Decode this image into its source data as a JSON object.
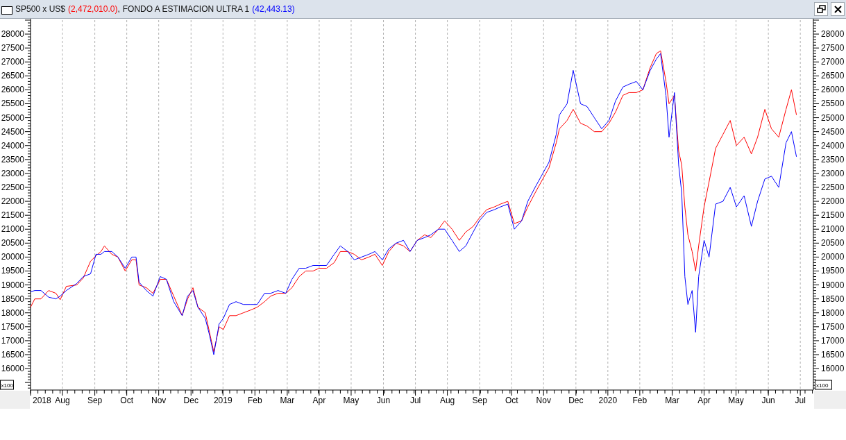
{
  "window": {
    "readings": [
      "(2,472,010.0)",
      "(42,443.13)"
    ],
    "separator": ","
  },
  "chart": {
    "y_multiplier_left": "x100",
    "y_multiplier_right": "x100",
    "left_axis_labels": [
      "28000",
      "27500",
      "27000",
      "26500",
      "26000",
      "25500",
      "25000",
      "24500",
      "24000",
      "23500",
      "23000",
      "22500",
      "22000",
      "21500",
      "21000",
      "20500",
      "20000",
      "19500",
      "19000",
      "18500",
      "18000",
      "17500",
      "17000",
      "16500",
      "16000"
    ],
    "right_axis_labels": [
      "28000",
      "27500",
      "27000",
      "26500",
      "26000",
      "25500",
      "25000",
      "24500",
      "24000",
      "23500",
      "23000",
      "22500",
      "22000",
      "21500",
      "21000",
      "20500",
      "20000",
      "19500",
      "19000",
      "18500",
      "18000",
      "17500",
      "17000",
      "16500",
      "16000"
    ],
    "chart_data": {
      "type": "line",
      "x": [
        2018.5,
        2018.511,
        2018.527,
        2018.547,
        2018.566,
        2018.577,
        2018.593,
        2018.62,
        2018.637,
        2018.656,
        2018.67,
        2018.683,
        2018.692,
        2018.711,
        2018.727,
        2018.746,
        2018.763,
        2018.774,
        2018.782,
        2018.801,
        2018.818,
        2018.837,
        2018.853,
        2018.872,
        2018.894,
        2018.908,
        2018.922,
        2018.935,
        2018.954,
        2018.965,
        2018.976,
        2018.99,
        2019.001,
        2019.017,
        2019.034,
        2019.053,
        2019.072,
        2019.089,
        2019.108,
        2019.124,
        2019.143,
        2019.163,
        2019.179,
        2019.198,
        2019.215,
        2019.234,
        2019.25,
        2019.269,
        2019.289,
        2019.305,
        2019.324,
        2019.341,
        2019.36,
        2019.379,
        2019.395,
        2019.414,
        2019.431,
        2019.45,
        2019.469,
        2019.486,
        2019.505,
        2019.524,
        2019.54,
        2019.56,
        2019.576,
        2019.595,
        2019.614,
        2019.631,
        2019.65,
        2019.666,
        2019.685,
        2019.705,
        2019.721,
        2019.74,
        2019.757,
        2019.776,
        2019.792,
        2019.811,
        2019.831,
        2019.847,
        2019.866,
        2019.874,
        2019.894,
        2019.91,
        2019.929,
        2019.946,
        2019.965,
        2019.984,
        2020.003,
        2020.02,
        2020.039,
        2020.055,
        2020.074,
        2020.091,
        2020.11,
        2020.126,
        2020.137,
        2020.151,
        2020.159,
        2020.173,
        2020.184,
        2020.192,
        2020.2,
        2020.208,
        2020.219,
        2020.228,
        2020.236,
        2020.25,
        2020.263,
        2020.28,
        2020.299,
        2020.318,
        2020.334,
        2020.354,
        2020.373,
        2020.389,
        2020.408,
        2020.425,
        2020.444,
        2020.463,
        2020.477,
        2020.49
      ],
      "series": [
        {
          "name": "SP500 x US$",
          "color": "#ff0000",
          "values": [
            18200,
            18500,
            18500,
            18800,
            18700,
            18470,
            18950,
            19000,
            19250,
            19850,
            20050,
            20200,
            20400,
            20100,
            20000,
            19500,
            19900,
            19900,
            19000,
            18900,
            18700,
            19200,
            19200,
            18600,
            17900,
            18500,
            18900,
            18200,
            18000,
            17300,
            16600,
            17500,
            17400,
            17900,
            17900,
            18000,
            18100,
            18200,
            18400,
            18600,
            18700,
            18700,
            18900,
            19300,
            19500,
            19500,
            19600,
            19600,
            19800,
            20200,
            20200,
            20100,
            19900,
            20000,
            20100,
            19700,
            20200,
            20500,
            20400,
            20200,
            20600,
            20800,
            20700,
            21000,
            21300,
            21000,
            20600,
            20900,
            21100,
            21400,
            21700,
            21800,
            21900,
            22000,
            21200,
            21300,
            21800,
            22300,
            22800,
            23200,
            24100,
            24600,
            24900,
            25300,
            24800,
            24700,
            24500,
            24500,
            24800,
            25200,
            25800,
            25900,
            25900,
            26000,
            26800,
            27300,
            27400,
            26300,
            25500,
            25800,
            23800,
            23300,
            21800,
            20800,
            20200,
            19500,
            20400,
            21800,
            22700,
            23900,
            24400,
            24900,
            24000,
            24300,
            23700,
            24300,
            25300,
            24600,
            24300,
            25300,
            26000,
            25100
          ]
        },
        {
          "name": "FONDO A ESTIMACION  ULTRA 1",
          "color": "#0000ff",
          "values": [
            18750,
            18800,
            18800,
            18560,
            18500,
            18600,
            18800,
            19050,
            19300,
            19400,
            20100,
            20100,
            20200,
            20200,
            20000,
            19600,
            20000,
            20000,
            19100,
            18800,
            18600,
            19300,
            19200,
            18400,
            17900,
            18600,
            18800,
            18200,
            17800,
            17200,
            16500,
            17600,
            17800,
            18300,
            18400,
            18300,
            18300,
            18300,
            18700,
            18700,
            18800,
            18700,
            19200,
            19600,
            19600,
            19700,
            19700,
            19700,
            20100,
            20400,
            20200,
            19900,
            20000,
            20100,
            20200,
            19900,
            20300,
            20500,
            20600,
            20200,
            20600,
            20700,
            20800,
            21000,
            21000,
            20600,
            20200,
            20400,
            20900,
            21300,
            21600,
            21700,
            21800,
            21900,
            21000,
            21300,
            22000,
            22500,
            23000,
            23400,
            24400,
            25100,
            25500,
            26700,
            25500,
            25400,
            25000,
            24600,
            24900,
            25600,
            26100,
            26200,
            26300,
            26000,
            26700,
            27100,
            27300,
            25800,
            24300,
            25900,
            23300,
            22300,
            19300,
            18300,
            18800,
            17300,
            19300,
            20600,
            20000,
            21900,
            22000,
            22500,
            21800,
            22200,
            21100,
            22000,
            22800,
            22900,
            22500,
            24100,
            24500,
            23600
          ]
        }
      ],
      "xlim": [
        2018.5,
        2020.534
      ],
      "ylim": [
        15230,
        28500
      ],
      "grid": true,
      "xticks": [
        {
          "value": 2018.5,
          "label": "2018"
        },
        {
          "value": 2018.583,
          "label": "Aug"
        },
        {
          "value": 2018.667,
          "label": "Sep"
        },
        {
          "value": 2018.75,
          "label": "Oct"
        },
        {
          "value": 2018.833,
          "label": "Nov"
        },
        {
          "value": 2018.917,
          "label": "Dec"
        },
        {
          "value": 2019,
          "label": "2019"
        },
        {
          "value": 2019.083,
          "label": "Feb"
        },
        {
          "value": 2019.167,
          "label": "Mar"
        },
        {
          "value": 2019.25,
          "label": "Apr"
        },
        {
          "value": 2019.333,
          "label": "May"
        },
        {
          "value": 2019.417,
          "label": "Jun"
        },
        {
          "value": 2019.5,
          "label": "Jul"
        },
        {
          "value": 2019.583,
          "label": "Aug"
        },
        {
          "value": 2019.667,
          "label": "Sep"
        },
        {
          "value": 2019.75,
          "label": "Oct"
        },
        {
          "value": 2019.833,
          "label": "Nov"
        },
        {
          "value": 2019.917,
          "label": "Dec"
        },
        {
          "value": 2020,
          "label": "2020"
        },
        {
          "value": 2020.083,
          "label": "Feb"
        },
        {
          "value": 2020.167,
          "label": "Mar"
        },
        {
          "value": 2020.25,
          "label": "Apr"
        },
        {
          "value": 2020.333,
          "label": "May"
        },
        {
          "value": 2020.417,
          "label": "Jun"
        },
        {
          "value": 2020.5,
          "label": "Jul"
        }
      ],
      "yticks": [
        16000,
        16500,
        17000,
        17500,
        18000,
        18500,
        19000,
        19500,
        20000,
        20500,
        21000,
        21500,
        22000,
        22500,
        23000,
        23500,
        24000,
        24500,
        25000,
        25500,
        26000,
        26500,
        27000,
        27500,
        28000
      ]
    }
  }
}
